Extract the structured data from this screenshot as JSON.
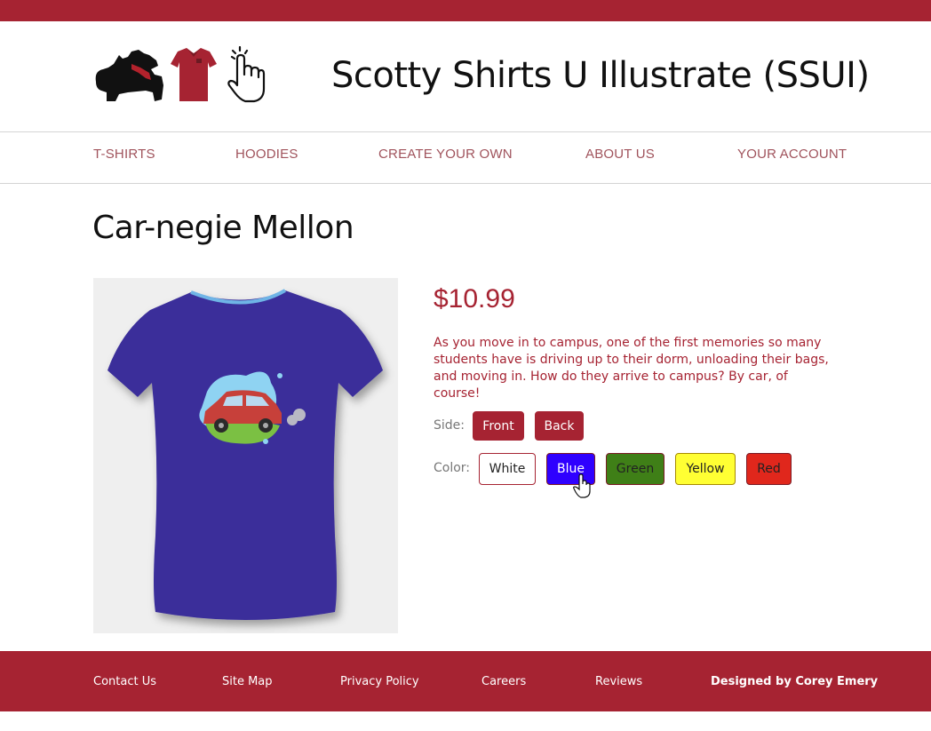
{
  "header": {
    "site_title": "Scotty Shirts U Illustrate (SSUI)",
    "logo_icons": [
      "scottie-dog-icon",
      "shirt-icon",
      "pointing-hand-icon"
    ]
  },
  "nav": {
    "items": [
      {
        "label": "T-SHIRTS"
      },
      {
        "label": "HOODIES"
      },
      {
        "label": "CREATE YOUR OWN"
      },
      {
        "label": "ABOUT US"
      },
      {
        "label": "YOUR ACCOUNT"
      }
    ]
  },
  "product": {
    "title": "Car-negie Mellon",
    "price": "$10.99",
    "description": "As you move in to campus, one of the first memories so many students have is driving up to their dorm, unloading their bags, and moving in. How do they arrive to campus? By car, of course!",
    "image_icon": "blue-tshirt-with-car-illustration",
    "side_label": "Side:",
    "sides": [
      "Front",
      "Back"
    ],
    "color_label": "Color:",
    "colors": [
      {
        "label": "White",
        "bg": "#ffffff",
        "fg": "#222222"
      },
      {
        "label": "Blue",
        "bg": "#2f00ff",
        "fg": "#ffffff"
      },
      {
        "label": "Green",
        "bg": "#3f7f17",
        "fg": "#222222"
      },
      {
        "label": "Yellow",
        "bg": "#ffff33",
        "fg": "#222222"
      },
      {
        "label": "Red",
        "bg": "#e0271c",
        "fg": "#222222"
      }
    ],
    "selected_color": "Blue",
    "shirt_color": "#3a2e9a"
  },
  "footer": {
    "links": [
      "Contact Us",
      "Site Map",
      "Privacy Policy",
      "Careers",
      "Reviews"
    ],
    "credit": "Designed by Corey Emery"
  },
  "theme": {
    "accent": "#a62332"
  }
}
